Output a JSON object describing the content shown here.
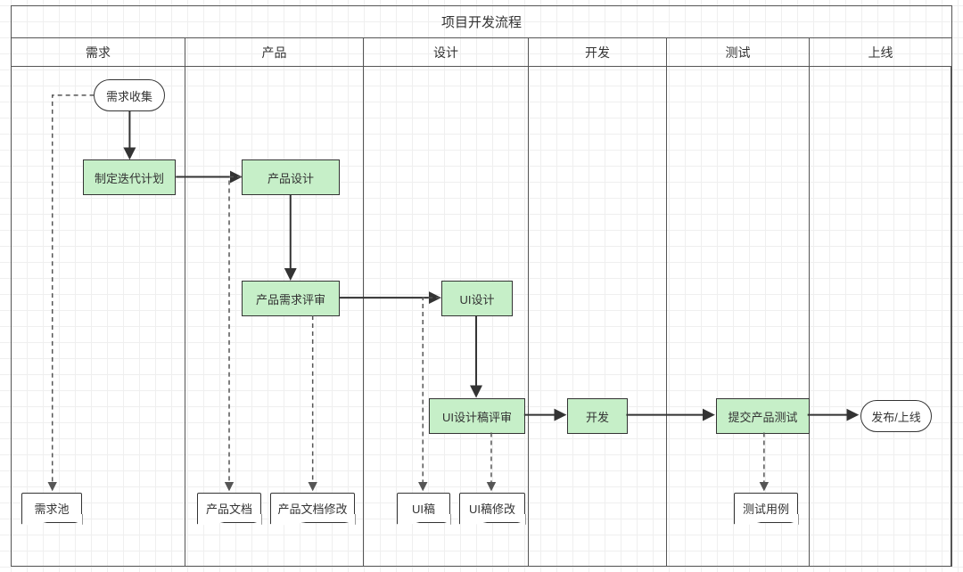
{
  "title": "项目开发流程",
  "lanes": [
    "需求",
    "产品",
    "设计",
    "开发",
    "测试",
    "上线"
  ],
  "nodes": {
    "collect": "需求收集",
    "iterPlan": "制定迭代计划",
    "prodDesign": "产品设计",
    "prodReview": "产品需求评审",
    "uiDesign": "UI设计",
    "uiReview": "UI设计稿评审",
    "dev": "开发",
    "submitTest": "提交产品测试",
    "release": "发布/上线",
    "reqPool": "需求池",
    "prodDoc": "产品文档",
    "prodDocMod": "产品文档修改",
    "uiDraft": "UI稿",
    "uiDraftMod": "UI稿修改",
    "testCase": "测试用例"
  }
}
